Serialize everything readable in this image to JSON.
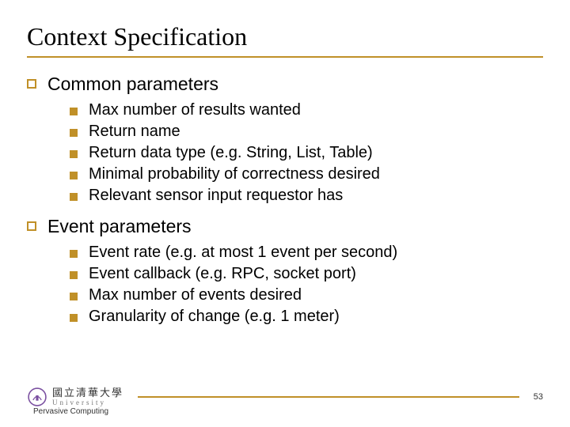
{
  "title": "Context Specification",
  "sections": [
    {
      "label": "Common parameters",
      "items": [
        "Max number of results wanted",
        "Return name",
        "Return data type (e.g. String, List, Table)",
        "Minimal probability of correctness desired",
        "Relevant sensor input requestor has"
      ]
    },
    {
      "label": "Event parameters",
      "items": [
        "Event rate (e.g. at most 1 event per second)",
        "Event callback (e.g. RPC, socket port)",
        "Max number of events desired",
        "Granularity of change (e.g. 1 meter)"
      ]
    }
  ],
  "footer": {
    "course": "Pervasive Computing",
    "university_cn": "國立清華大學",
    "university_en": "University",
    "page": "53"
  }
}
